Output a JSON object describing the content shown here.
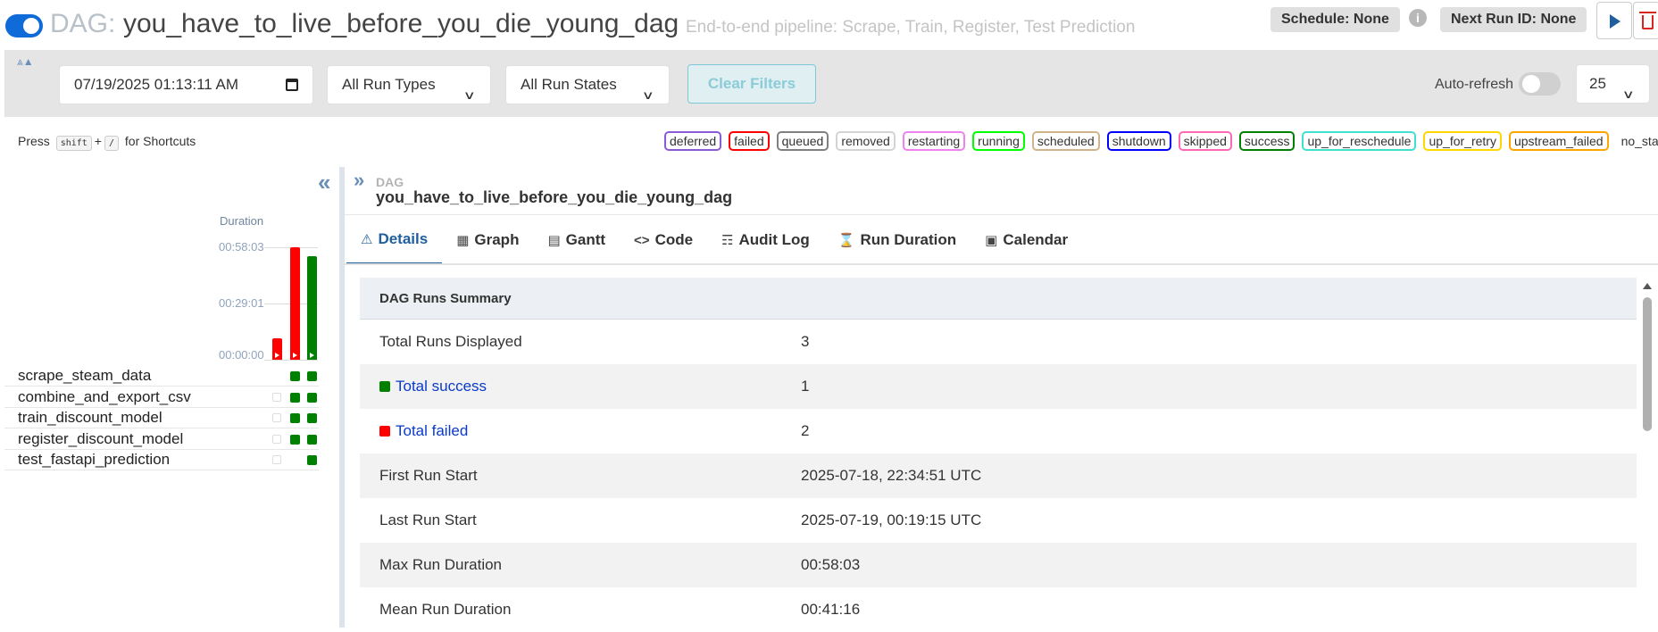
{
  "header": {
    "dag_prefix": "DAG:",
    "dag_id": "you_have_to_live_before_you_die_young_dag",
    "description": "End-to-end pipeline: Scrape, Train, Register, Test Prediction",
    "schedule": "Schedule: None",
    "next_run": "Next Run ID: None",
    "info_glyph": "i"
  },
  "filters": {
    "date_value": "07/19/2025 01:13:11 AM",
    "run_types": "All Run Types",
    "run_states": "All Run States",
    "clear_label": "Clear Filters",
    "autorefresh_label": "Auto-refresh",
    "page_size": "25"
  },
  "shortcuts": {
    "press": "Press",
    "key1": "shift",
    "plus": "+",
    "key2": "/",
    "suffix": "for Shortcuts"
  },
  "legend": [
    {
      "label": "deferred",
      "color": "#8a5bd6"
    },
    {
      "label": "failed",
      "color": "#ff0000"
    },
    {
      "label": "queued",
      "color": "#808080"
    },
    {
      "label": "removed",
      "color": "#d3d3d3"
    },
    {
      "label": "restarting",
      "color": "#ee82ee"
    },
    {
      "label": "running",
      "color": "#00ff00"
    },
    {
      "label": "scheduled",
      "color": "#d2b48c"
    },
    {
      "label": "shutdown",
      "color": "#0000ff"
    },
    {
      "label": "skipped",
      "color": "#ff69b4"
    },
    {
      "label": "success",
      "color": "#008000"
    },
    {
      "label": "up_for_reschedule",
      "color": "#40e0d0"
    },
    {
      "label": "up_for_retry",
      "color": "#ffd700"
    },
    {
      "label": "upstream_failed",
      "color": "#ffa500"
    }
  ],
  "legend_no_status": "no_status",
  "grid": {
    "duration_label": "Duration",
    "ticks": [
      "00:58:03",
      "00:29:01",
      "00:00:00"
    ],
    "runs": [
      {
        "state": "failed",
        "duration_fraction": 0.19
      },
      {
        "state": "failed",
        "duration_fraction": 1.0
      },
      {
        "state": "success",
        "duration_fraction": 0.92
      }
    ],
    "tasks": [
      {
        "name": "scrape_steam_data",
        "states": [
          "none",
          "success",
          "success"
        ]
      },
      {
        "name": "combine_and_export_csv",
        "states": [
          "empty",
          "success",
          "success"
        ]
      },
      {
        "name": "train_discount_model",
        "states": [
          "empty",
          "success",
          "success"
        ]
      },
      {
        "name": "register_discount_model",
        "states": [
          "empty",
          "success",
          "success"
        ]
      },
      {
        "name": "test_fastapi_prediction",
        "states": [
          "empty",
          "none",
          "success"
        ]
      }
    ]
  },
  "colors": {
    "success": "#008000",
    "failed": "#ff0000",
    "accent": "#1f5f9e"
  },
  "details": {
    "breadcrumb_label": "DAG",
    "breadcrumb_title": "you_have_to_live_before_you_die_young_dag",
    "tabs": [
      {
        "label": "Details",
        "icon": "warning-triangle-icon"
      },
      {
        "label": "Graph",
        "icon": "graph-icon"
      },
      {
        "label": "Gantt",
        "icon": "gantt-icon"
      },
      {
        "label": "Code",
        "icon": "code-icon"
      },
      {
        "label": "Audit Log",
        "icon": "audit-log-icon"
      },
      {
        "label": "Run Duration",
        "icon": "hourglass-icon"
      },
      {
        "label": "Calendar",
        "icon": "calendar-icon"
      }
    ],
    "summary_title": "DAG Runs Summary",
    "rows": [
      {
        "label": "Total Runs Displayed",
        "value": "3"
      },
      {
        "label": "Total success",
        "value": "1"
      },
      {
        "label": "Total failed",
        "value": "2"
      },
      {
        "label": "First Run Start",
        "value": "2025-07-18, 22:34:51 UTC"
      },
      {
        "label": "Last Run Start",
        "value": "2025-07-19, 00:19:15 UTC"
      },
      {
        "label": "Max Run Duration",
        "value": "00:58:03"
      },
      {
        "label": "Mean Run Duration",
        "value": "00:41:16"
      }
    ]
  }
}
